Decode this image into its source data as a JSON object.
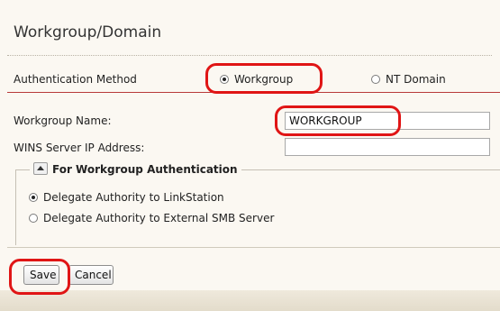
{
  "page": {
    "title": "Workgroup/Domain"
  },
  "auth": {
    "label": "Authentication Method",
    "options": [
      {
        "label": "Workgroup",
        "selected": true
      },
      {
        "label": "NT Domain",
        "selected": false
      }
    ]
  },
  "fields": {
    "workgroup_name_label": "Workgroup Name:",
    "workgroup_name_value": "WORKGROUP",
    "wins_label": "WINS Server IP Address:",
    "wins_value": ""
  },
  "workgroup_auth": {
    "legend": "For Workgroup Authentication",
    "options": [
      {
        "label": "Delegate Authority to LinkStation",
        "selected": true
      },
      {
        "label": "Delegate Authority to External SMB Server",
        "selected": false
      }
    ]
  },
  "buttons": {
    "save": "Save",
    "cancel": "Cancel"
  },
  "colors": {
    "highlight": "#e01515",
    "separator": "#b83a3a",
    "background": "#fbf8f2"
  }
}
